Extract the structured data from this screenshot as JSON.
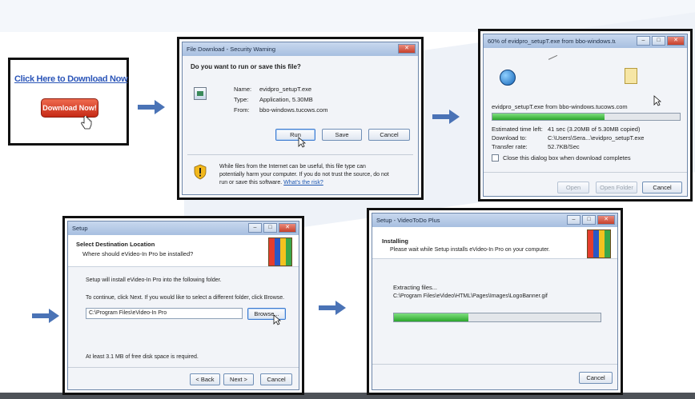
{
  "step1": {
    "link_text": "Click Here to Download Now",
    "button_label": "Download Now!"
  },
  "security_dialog": {
    "title": "File Download - Security Warning",
    "question": "Do you want to run or save this file?",
    "name_label": "Name:",
    "name_value": "evidpro_setupT.exe",
    "type_label": "Type:",
    "type_value": "Application, 5.30MB",
    "from_label": "From:",
    "from_value": "bbo-windows.tucows.com",
    "run_label": "Run",
    "save_label": "Save",
    "cancel_label": "Cancel",
    "warning_line1": "While files from the Internet can be useful, this file type can",
    "warning_line2": "potentially harm your computer. If you do not trust the source, do not",
    "warning_line3": "run or save this software.",
    "warning_link": "What's the risk?"
  },
  "download_dialog": {
    "title": "60% of evidpro_setupT.exe from bbo-windows.tu...",
    "file_line": "evidpro_setupT.exe from bbo-windows.tucows.com",
    "progress_fraction": 0.6,
    "est_label": "Estimated time left:",
    "est_value": "41 sec (3.20MB of 5.30MB copied)",
    "download_to_label": "Download to:",
    "download_to_value": "C:\\Users\\Sera...\\evidpro_setupT.exe",
    "rate_label": "Transfer rate:",
    "rate_value": "52.7KB/Sec",
    "close_checkbox_label": "Close this dialog box when download completes",
    "open_label": "Open",
    "open_folder_label": "Open Folder",
    "cancel_label": "Cancel"
  },
  "setup_dialog": {
    "title": "Setup",
    "heading": "Select Destination Location",
    "subheading": "Where should eVideo-In Pro be installed?",
    "line1": "Setup will install eVideo-In Pro into the following folder.",
    "line2": "To continue, click Next. If you would like to select a different folder, click Browse.",
    "path_value": "C:\\Program Files\\eVideo-In Pro",
    "browse_label": "Browse...",
    "space_text": "At least 3.1 MB of free disk space is required.",
    "back_label": "< Back",
    "next_label": "Next >",
    "cancel_label": "Cancel"
  },
  "install_dialog": {
    "title": "Setup - VideoToDo Plus",
    "heading": "Installing",
    "subheading": "Please wait while Setup installs eVideo-In Pro on your computer.",
    "extract_label": "Extracting files...",
    "extract_path": "C:\\Program Files\\eVideo\\HTML\\Pages\\Images\\LogoBanner.gif",
    "progress_fraction": 0.36,
    "cancel_label": "Cancel"
  },
  "colors": {
    "arrow": "#4a73b6",
    "progress": "#2ca52c",
    "download_button": "#d9331e",
    "link": "#2b55b8"
  }
}
